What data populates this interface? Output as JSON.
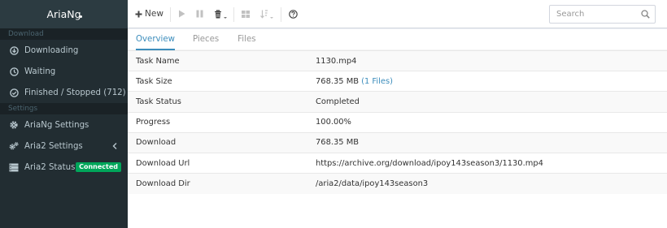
{
  "app": {
    "title": "AriaNg"
  },
  "sidebar": {
    "sections": [
      {
        "header": "Download",
        "items": [
          {
            "label": "Downloading",
            "icon": "arrow-circle-down-icon"
          },
          {
            "label": "Waiting",
            "icon": "clock-icon"
          },
          {
            "label": "Finished / Stopped (712)",
            "icon": "check-circle-icon"
          }
        ]
      },
      {
        "header": "Settings",
        "items": [
          {
            "label": "AriaNg Settings",
            "icon": "gear-icon"
          },
          {
            "label": "Aria2 Settings",
            "icon": "gears-icon"
          },
          {
            "label": "Aria2 Status",
            "icon": "server-icon",
            "badge": "Connected"
          }
        ]
      }
    ]
  },
  "toolbar": {
    "new_label": "New",
    "search_placeholder": "Search"
  },
  "tabs": [
    {
      "label": "Overview",
      "active": true
    },
    {
      "label": "Pieces",
      "active": false
    },
    {
      "label": "Files",
      "active": false
    }
  ],
  "overview": {
    "rows": [
      {
        "key": "Task Name",
        "value": "1130.mp4"
      },
      {
        "key": "Task Size",
        "value": "768.35 MB",
        "link": "(1 Files)"
      },
      {
        "key": "Task Status",
        "value": "Completed"
      },
      {
        "key": "Progress",
        "value": "100.00%"
      },
      {
        "key": "Download",
        "value": "768.35 MB"
      },
      {
        "key": "Download Url",
        "value": "https://archive.org/download/ipoy143season3/1130.mp4"
      },
      {
        "key": "Download Dir",
        "value": "/aria2/data/ipoy143season3"
      }
    ]
  },
  "colors": {
    "sidebar_bg": "#222d32",
    "accent": "#3c8dbc",
    "badge_green": "#00a65a"
  }
}
